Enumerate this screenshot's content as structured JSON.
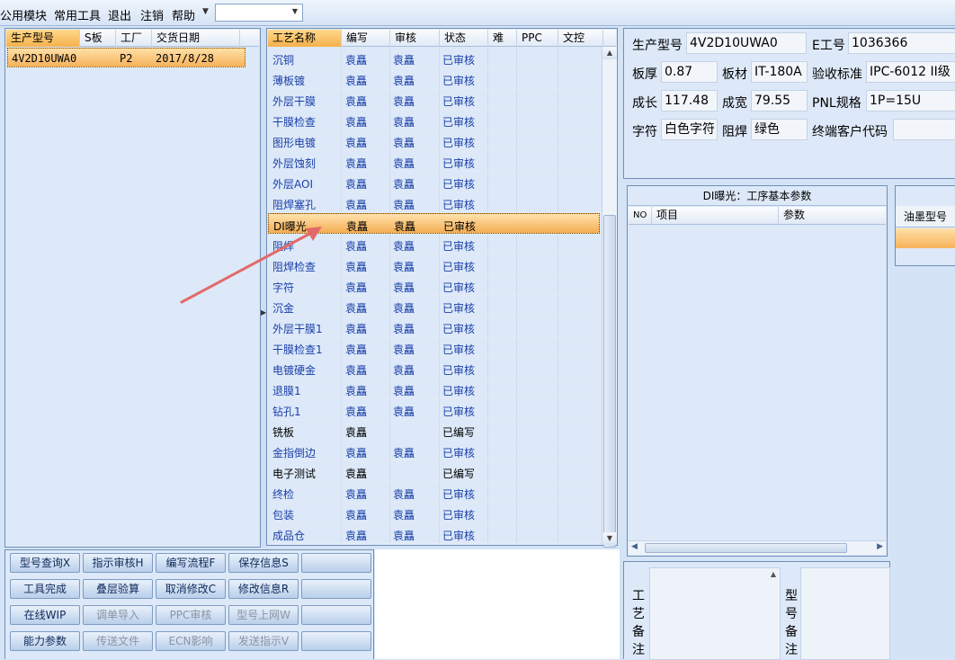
{
  "menu": {
    "items": [
      "公用模块",
      "常用工具",
      "退出",
      "注销",
      "帮助"
    ],
    "combo_value": ""
  },
  "model_table": {
    "headers": [
      "生产型号",
      "S板",
      "工厂",
      "交货日期"
    ],
    "rows": [
      {
        "model": "4V2D10UWA0",
        "s": "",
        "factory": "P2",
        "date": "2017/8/28"
      }
    ]
  },
  "process_table": {
    "headers": [
      "工艺名称",
      "编写",
      "审核",
      "状态",
      "难",
      "PPC",
      "文控"
    ],
    "selected_index": 8,
    "rows": [
      {
        "name": "沉铜",
        "writer": "袁矗",
        "reviewer": "袁矗",
        "status": "已审核"
      },
      {
        "name": "薄板镀",
        "writer": "袁矗",
        "reviewer": "袁矗",
        "status": "已审核"
      },
      {
        "name": "外层干膜",
        "writer": "袁矗",
        "reviewer": "袁矗",
        "status": "已审核"
      },
      {
        "name": "干膜检查",
        "writer": "袁矗",
        "reviewer": "袁矗",
        "status": "已审核"
      },
      {
        "name": "图形电镀",
        "writer": "袁矗",
        "reviewer": "袁矗",
        "status": "已审核"
      },
      {
        "name": "外层蚀刻",
        "writer": "袁矗",
        "reviewer": "袁矗",
        "status": "已审核"
      },
      {
        "name": "外层AOI",
        "writer": "袁矗",
        "reviewer": "袁矗",
        "status": "已审核"
      },
      {
        "name": "阻焊塞孔",
        "writer": "袁矗",
        "reviewer": "袁矗",
        "status": "已审核"
      },
      {
        "name": "DI曝光",
        "writer": "袁矗",
        "reviewer": "袁矗",
        "status": "已审核"
      },
      {
        "name": "阻焊",
        "writer": "袁矗",
        "reviewer": "袁矗",
        "status": "已审核"
      },
      {
        "name": "阻焊检查",
        "writer": "袁矗",
        "reviewer": "袁矗",
        "status": "已审核"
      },
      {
        "name": "字符",
        "writer": "袁矗",
        "reviewer": "袁矗",
        "status": "已审核"
      },
      {
        "name": "沉金",
        "writer": "袁矗",
        "reviewer": "袁矗",
        "status": "已审核"
      },
      {
        "name": "外层干膜1",
        "writer": "袁矗",
        "reviewer": "袁矗",
        "status": "已审核"
      },
      {
        "name": "干膜检查1",
        "writer": "袁矗",
        "reviewer": "袁矗",
        "status": "已审核"
      },
      {
        "name": "电镀硬金",
        "writer": "袁矗",
        "reviewer": "袁矗",
        "status": "已审核"
      },
      {
        "name": "退膜1",
        "writer": "袁矗",
        "reviewer": "袁矗",
        "status": "已审核"
      },
      {
        "name": "钻孔1",
        "writer": "袁矗",
        "reviewer": "袁矗",
        "status": "已审核"
      },
      {
        "name": "铣板",
        "writer": "袁矗",
        "reviewer": "",
        "status": "已编写"
      },
      {
        "name": "金指倒边",
        "writer": "袁矗",
        "reviewer": "袁矗",
        "status": "已审核"
      },
      {
        "name": "电子测试",
        "writer": "袁矗",
        "reviewer": "",
        "status": "已编写"
      },
      {
        "name": "终检",
        "writer": "袁矗",
        "reviewer": "袁矗",
        "status": "已审核"
      },
      {
        "name": "包装",
        "writer": "袁矗",
        "reviewer": "袁矗",
        "status": "已审核"
      },
      {
        "name": "成品仓",
        "writer": "袁矗",
        "reviewer": "袁矗",
        "status": "已审核"
      }
    ]
  },
  "info": {
    "prod_model_label": "生产型号",
    "prod_model": "4V2D10UWA0",
    "e_no_label": "E工号",
    "e_no": "1036366",
    "thickness_label": "板厚",
    "thickness": "0.87",
    "material_label": "板材",
    "material": "IT-180A",
    "standard_label": "验收标准",
    "standard": "IPC-6012 II级",
    "length_label": "成长",
    "length": "117.48",
    "width_label": "成宽",
    "width": "79.55",
    "pnl_label": "PNL规格",
    "pnl": "1P=15U",
    "legend_label": "字符",
    "legend": "白色字符",
    "mask_label": "阻焊",
    "mask": "绿色",
    "customer_label": "终端客户代码",
    "customer": ""
  },
  "params": {
    "title": "DI曝光：工序基本参数",
    "headers": [
      "NO",
      "项目",
      "参数"
    ]
  },
  "ink": {
    "header": "油墨型号"
  },
  "buttons": [
    [
      "型号查询X",
      "指示审核H",
      "编写流程F",
      "保存信息S",
      ""
    ],
    [
      "工具完成",
      "叠层验算",
      "取消修改C",
      "修改信息R",
      ""
    ],
    [
      "在线WIP",
      "调单导入",
      "PPC审核",
      "型号上网W",
      ""
    ],
    [
      "能力参数",
      "传送文件",
      "ECN影响",
      "发送指示V",
      ""
    ]
  ],
  "notes": {
    "process_remark": "工艺备注",
    "model_remark": "型号备注"
  }
}
